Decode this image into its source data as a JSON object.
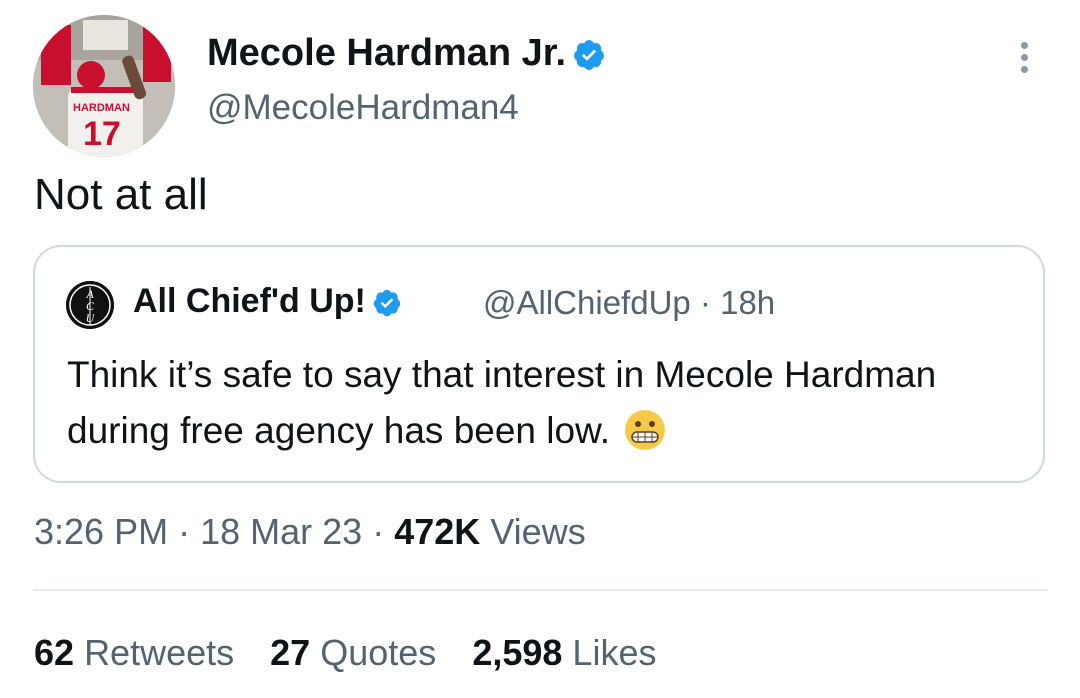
{
  "author": {
    "name": "Mecole Hardman Jr.",
    "handle": "@MecoleHardman4",
    "avatar_jersey_name": "HARDMAN",
    "avatar_jersey_number": "17"
  },
  "tweet": {
    "text": "Not at all"
  },
  "quoted": {
    "name": "All Chief'd Up!",
    "handle": "@AllChiefdUp",
    "separator": "·",
    "time": "18h",
    "logo_text": "ACU",
    "text": "Think it’s safe to say that interest in Mecole Hardman during free agency has been low.",
    "emoji": "grimacing-face"
  },
  "meta": {
    "time": "3:26 PM",
    "separator": "·",
    "date": "18 Mar 23",
    "views_count": "472K",
    "views_label": "Views"
  },
  "stats": {
    "retweets_count": "62",
    "retweets_label": "Retweets",
    "quotes_count": "27",
    "quotes_label": "Quotes",
    "likes_count": "2,598",
    "likes_label": "Likes"
  },
  "colors": {
    "verified_blue": "#1d9bf0",
    "secondary_text": "#536471",
    "primary_text": "#0f1419",
    "border": "#cfd9de"
  }
}
